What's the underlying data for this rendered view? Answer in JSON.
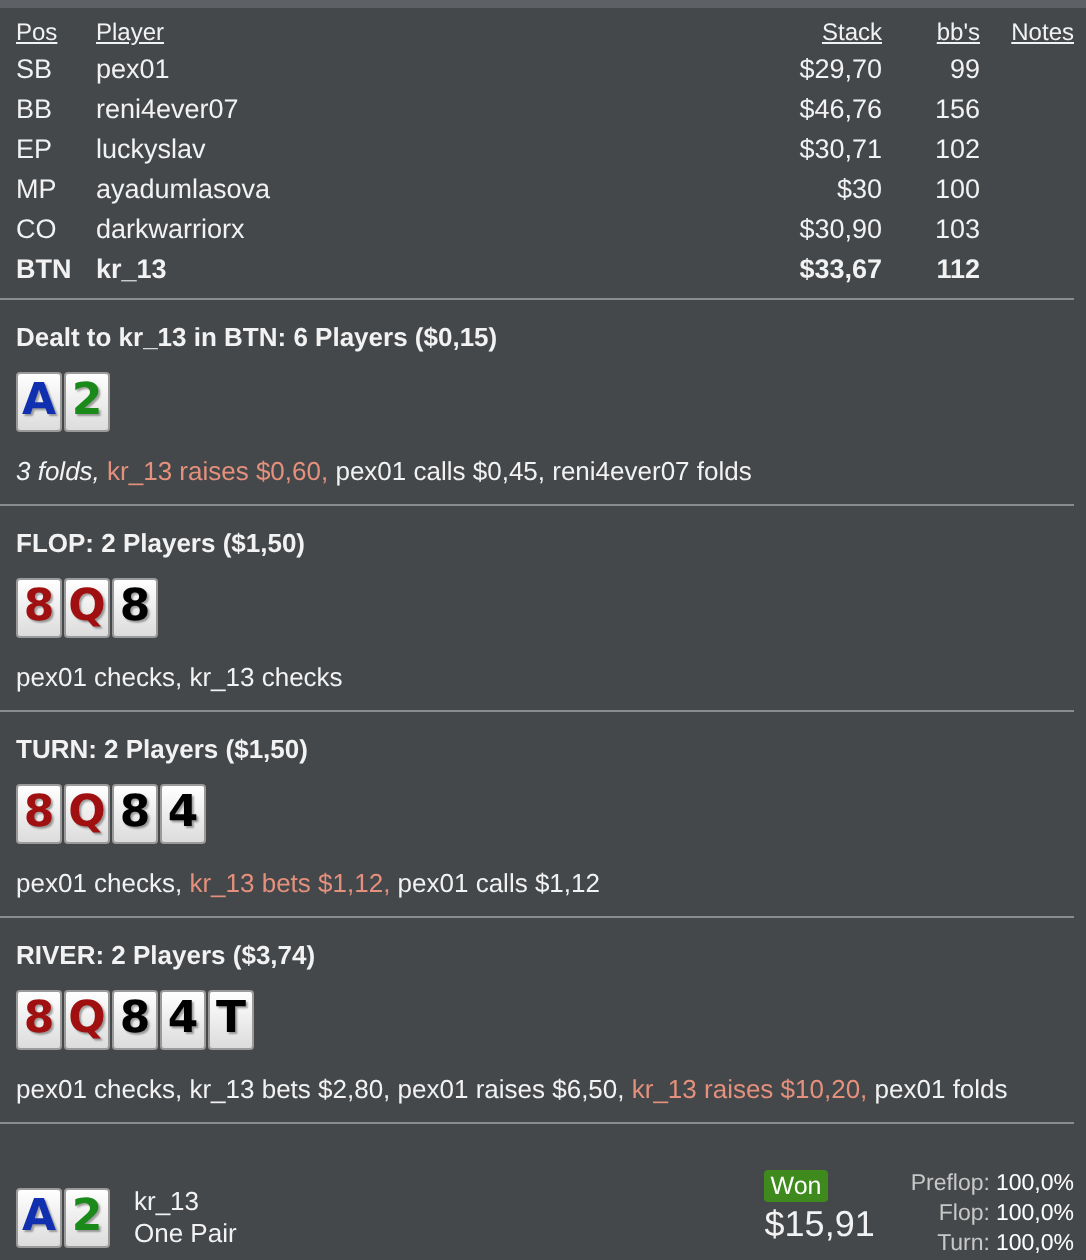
{
  "players": {
    "columns": [
      "Pos",
      "Player",
      "Stack",
      "bb's",
      "Notes"
    ],
    "rows": [
      {
        "pos": "SB",
        "player": "pex01",
        "stack": "$29,70",
        "bbs": "99",
        "hero": false
      },
      {
        "pos": "BB",
        "player": "reni4ever07",
        "stack": "$46,76",
        "bbs": "156",
        "hero": false
      },
      {
        "pos": "EP",
        "player": "luckyslav",
        "stack": "$30,71",
        "bbs": "102",
        "hero": false
      },
      {
        "pos": "MP",
        "player": "ayadumlasova",
        "stack": "$30",
        "bbs": "100",
        "hero": false
      },
      {
        "pos": "CO",
        "player": "darkwarriorx",
        "stack": "$30,90",
        "bbs": "103",
        "hero": false
      },
      {
        "pos": "BTN",
        "player": "kr_13",
        "stack": "$33,67",
        "bbs": "112",
        "hero": true
      }
    ]
  },
  "streets": [
    {
      "title": "Dealt to kr_13 in BTN: 6 Players ($0,15)",
      "cards": [
        {
          "rank": "A",
          "color": "#1030b0"
        },
        {
          "rank": "2",
          "color": "#1a8a1a"
        }
      ],
      "actions": [
        {
          "text": "3 folds, ",
          "kind": "fold"
        },
        {
          "text": "kr_13 raises $0,60,",
          "kind": "hero"
        },
        {
          "text": " pex01 calls $0,45, reni4ever07 folds",
          "kind": "plain"
        }
      ]
    },
    {
      "title": "FLOP: 2 Players ($1,50)",
      "cards": [
        {
          "rank": "8",
          "color": "#a01010"
        },
        {
          "rank": "Q",
          "color": "#a01010"
        },
        {
          "rank": "8",
          "color": "#000000"
        }
      ],
      "actions": [
        {
          "text": "pex01 checks, kr_13 checks",
          "kind": "plain"
        }
      ]
    },
    {
      "title": "TURN: 2 Players ($1,50)",
      "cards": [
        {
          "rank": "8",
          "color": "#a01010"
        },
        {
          "rank": "Q",
          "color": "#a01010"
        },
        {
          "rank": "8",
          "color": "#000000"
        },
        {
          "rank": "4",
          "color": "#000000"
        }
      ],
      "actions": [
        {
          "text": "pex01 checks, ",
          "kind": "plain"
        },
        {
          "text": "kr_13 bets $1,12,",
          "kind": "hero"
        },
        {
          "text": " pex01 calls $1,12",
          "kind": "plain"
        }
      ]
    },
    {
      "title": "RIVER: 2 Players ($3,74)",
      "cards": [
        {
          "rank": "8",
          "color": "#a01010"
        },
        {
          "rank": "Q",
          "color": "#a01010"
        },
        {
          "rank": "8",
          "color": "#000000"
        },
        {
          "rank": "4",
          "color": "#000000"
        },
        {
          "rank": "T",
          "color": "#000000"
        }
      ],
      "actions": [
        {
          "text": "pex01 checks, kr_13 bets $2,80, pex01 raises $6,50, ",
          "kind": "plain"
        },
        {
          "text": "kr_13 raises $10,20,",
          "kind": "hero"
        },
        {
          "text": " pex01 folds",
          "kind": "plain"
        }
      ]
    }
  ],
  "result": {
    "cards": [
      {
        "rank": "A",
        "color": "#1030b0"
      },
      {
        "rank": "2",
        "color": "#1a8a1a"
      }
    ],
    "player": "kr_13",
    "hand": "One Pair",
    "badge": "Won",
    "amount": "$15,91",
    "equities": [
      {
        "label": "Preflop:",
        "value": "100,0%"
      },
      {
        "label": "Flop:",
        "value": "100,0%"
      },
      {
        "label": "Turn:",
        "value": "100,0%"
      }
    ]
  }
}
